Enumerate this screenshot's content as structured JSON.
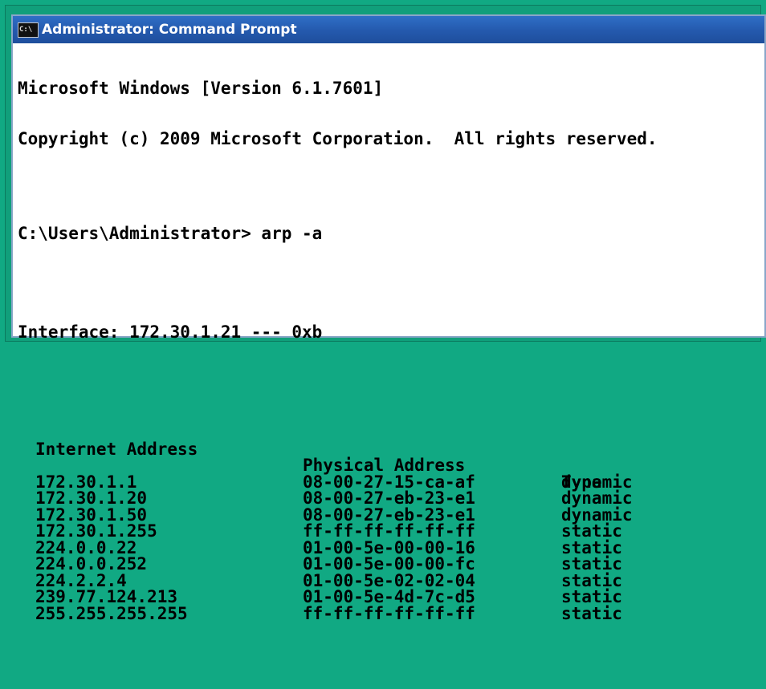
{
  "window": {
    "title": "Administrator: Command Prompt",
    "icon_label": "C:\\"
  },
  "console": {
    "line1": "Microsoft Windows [Version 6.1.7601]",
    "line2": "Copyright (c) 2009 Microsoft Corporation.  All rights reserved.",
    "prompt": "C:\\Users\\Administrator> arp -a",
    "interface_line": "Interface: 172.30.1.21 --- 0xb",
    "headers": [
      "Internet Address",
      "Physical Address",
      "Type"
    ],
    "rows": [
      [
        "172.30.1.1",
        "08-00-27-15-ca-af",
        "dynamic"
      ],
      [
        "172.30.1.20",
        "08-00-27-eb-23-e1",
        "dynamic"
      ],
      [
        "172.30.1.50",
        "08-00-27-eb-23-e1",
        "dynamic"
      ],
      [
        "172.30.1.255",
        "ff-ff-ff-ff-ff-ff",
        "static"
      ],
      [
        "224.0.0.22",
        "01-00-5e-00-00-16",
        "static"
      ],
      [
        "224.0.0.252",
        "01-00-5e-00-00-fc",
        "static"
      ],
      [
        "224.2.2.4",
        "01-00-5e-02-02-04",
        "static"
      ],
      [
        "239.77.124.213",
        "01-00-5e-4d-7c-d5",
        "static"
      ],
      [
        "255.255.255.255",
        "ff-ff-ff-ff-ff-ff",
        "static"
      ]
    ]
  }
}
